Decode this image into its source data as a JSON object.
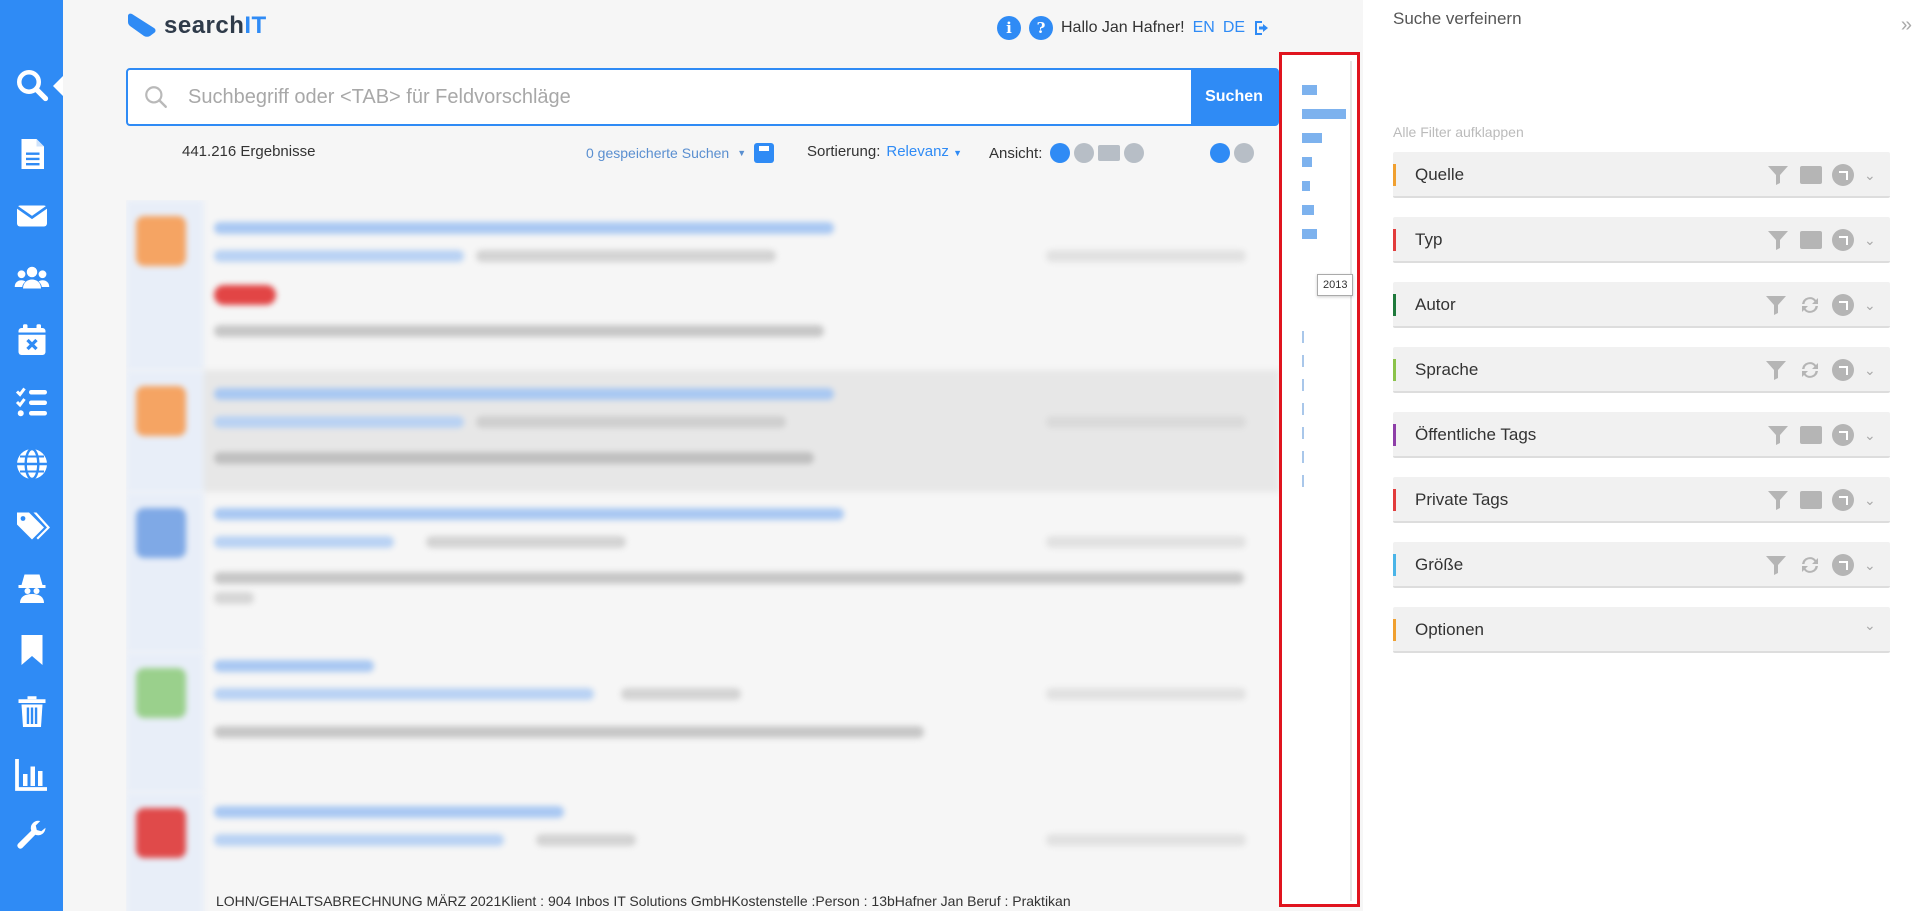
{
  "app": {
    "logo_text_a": "search",
    "logo_text_b": "IT"
  },
  "header": {
    "greeting": "Hallo Jan Hafner!",
    "lang_en": "EN",
    "lang_de": "DE"
  },
  "search": {
    "placeholder": "Suchbegriff oder <TAB> für Feldvorschläge",
    "button_label": "Suchen"
  },
  "results_meta": {
    "count": "441.216 Ergebnisse",
    "saved_searches": "0 gespeicherte Suchen",
    "sort_label": "Sortierung:",
    "sort_value": "Relevanz",
    "view_label": "Ansicht:"
  },
  "results": {
    "bottom_text": "LOHN/GEHALTSABRECHNUNG MÄRZ 2021Klient : 904 Inbos IT Solutions GmbHKostenstelle :Person : 13bHafner Jan Beruf : Praktikan"
  },
  "timeline": {
    "tooltip": "2013",
    "bars": [
      0.15,
      0.45,
      0.2,
      0.1,
      0.08,
      0.12,
      0.15
    ],
    "ticks": 7
  },
  "refine": {
    "title": "Suche verfeinern",
    "expand_all": "Alle Filter aufklappen",
    "facets": [
      {
        "label": "Quelle",
        "color": "#f0a030",
        "second_icon": "folder-icon"
      },
      {
        "label": "Typ",
        "color": "#e23c3c",
        "second_icon": "folder-icon"
      },
      {
        "label": "Autor",
        "color": "#1f7a3c",
        "second_icon": "refresh-icon"
      },
      {
        "label": "Sprache",
        "color": "#8bc34a",
        "second_icon": "refresh-icon"
      },
      {
        "label": "Öffentliche Tags",
        "color": "#8e3fa8",
        "second_icon": "folder-icon"
      },
      {
        "label": "Private Tags",
        "color": "#e23c3c",
        "second_icon": "folder-icon"
      },
      {
        "label": "Größe",
        "color": "#4bb5e8",
        "second_icon": "refresh-icon"
      },
      {
        "label": "Optionen",
        "color": "#f0a030",
        "second_icon": "none"
      }
    ]
  },
  "colors": {
    "accent": "#2f8bf5",
    "highlight_border": "#e0141e"
  }
}
